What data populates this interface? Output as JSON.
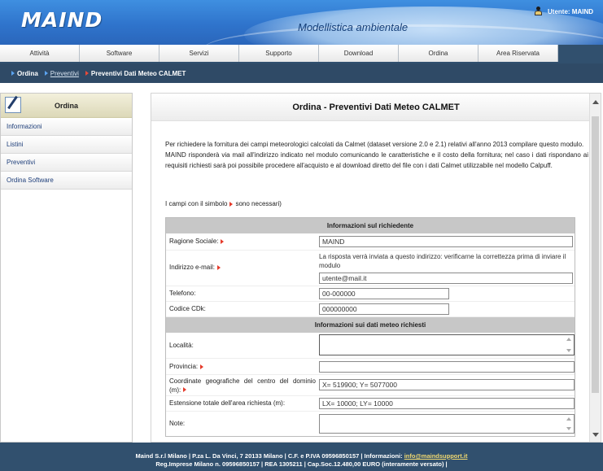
{
  "header": {
    "logo": "MAIND",
    "tagline": "Modellistica ambientale",
    "user": "Utente: MAIND"
  },
  "nav": {
    "tabs": [
      "Attività",
      "Software",
      "Servizi",
      "Supporto",
      "Download",
      "Ordina",
      "Area Riservata"
    ]
  },
  "breadcrumb": {
    "first": "Ordina",
    "second": "Preventivi",
    "current": "Preventivi Dati Meteo CALMET"
  },
  "sidebar": {
    "title": "Ordina",
    "items": [
      "Informazioni",
      "Listini",
      "Preventivi",
      "Ordina Software"
    ]
  },
  "main": {
    "title": "Ordina - Preventivi Dati Meteo CALMET",
    "intro_p1": "Per richiedere la fornitura dei campi meteorologici calcolati da Calmet (dataset versione 2.0 e 2.1) relativi all'anno 2013 compilare questo modulo.",
    "intro_p2": "MAIND risponderà via mail all'indirizzo indicato nel modulo comunicando le caratteristiche e il costo della fornitura; nel caso i dati rispondano ai requisiti richiesti sarà poi possibile procedere all'acquisto e al download diretto del file con i dati Calmet utilizzabile nel modello Calpuff.",
    "required_before": "I campi con il simbolo",
    "required_after": "sono necessari)"
  },
  "form": {
    "section1": "Informazioni sul richiedente",
    "section2": "Informazioni sui dati meteo richiesti",
    "ragione_sociale": {
      "label": "Ragione Sociale:",
      "value": "MAIND"
    },
    "email": {
      "label": "Indirizzo e-mail:",
      "hint": "La risposta verrà inviata a questo indirizzo: verificarne la correttezza prima di inviare il modulo",
      "value": "utente@mail.it"
    },
    "telefono": {
      "label": "Telefono:",
      "value": "00-000000"
    },
    "codice": {
      "label": "Codice CDk:",
      "value": "000000000"
    },
    "localita": {
      "label": "Località:",
      "value": ""
    },
    "provincia": {
      "label": "Provincia:",
      "value": ""
    },
    "coordinate": {
      "label": "Coordinate geografiche del centro del dominio (m):",
      "value": "X= 519900; Y= 5077000"
    },
    "estensione": {
      "label": "Estensione totale dell'area richiesta (m):",
      "value": "LX= 10000; LY= 10000"
    },
    "note": {
      "label": "Note:",
      "value": ""
    }
  },
  "footer": {
    "line1_pre": "Maind S.r.l Milano |  P.za L. Da Vinci, 7  20133 Milano | C.F. e P.IVA 09596850157 |  Informazioni: ",
    "email": "info@maindsupport.it",
    "line2": "Reg.Imprese Milano n. 09596850157 | REA 1305211 | Cap.Soc.12.480,00 EURO (interamente versato) |"
  },
  "colors": {
    "header_blue": "#2f74cc",
    "nav_dark": "#31506e",
    "required_arrow": "#e53a2a",
    "footer_link": "#f0d870"
  }
}
